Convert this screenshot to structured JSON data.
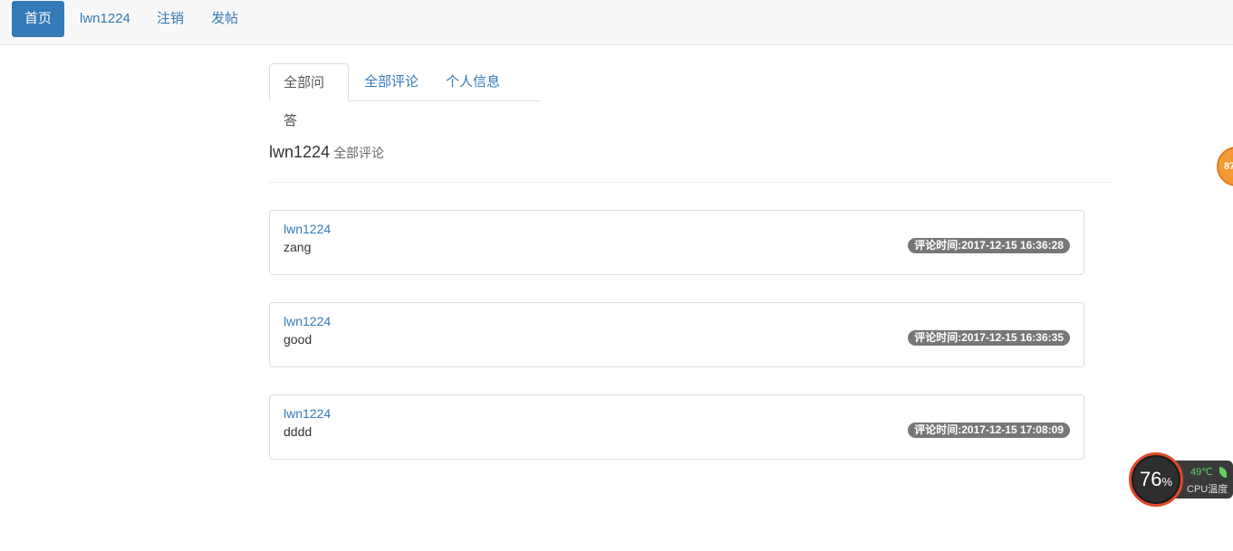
{
  "nav": {
    "home": "首页",
    "user": "lwn1224",
    "logout": "注销",
    "post": "发帖"
  },
  "tabs": [
    {
      "label": "全部问答",
      "active": true
    },
    {
      "label": "全部评论",
      "active": false
    },
    {
      "label": "个人信息",
      "active": false
    }
  ],
  "header": {
    "user": "lwn1224",
    "subtitle": "全部评论"
  },
  "comments": [
    {
      "author": "lwn1224",
      "text": "zang",
      "time": "评论时间:2017-12-15 16:36:28"
    },
    {
      "author": "lwn1224",
      "text": "good",
      "time": "评论时间:2017-12-15 16:36:35"
    },
    {
      "author": "lwn1224",
      "text": "dddd",
      "time": "评论时间:2017-12-15 17:08:09"
    }
  ],
  "edge_widget": {
    "value": "87"
  },
  "cpu_widget": {
    "usage": "76",
    "unit": "%",
    "temp": "49℃",
    "label": "CPU温度",
    "colors": {
      "ring": "#e04a2a",
      "temp": "#5fd35f"
    }
  }
}
